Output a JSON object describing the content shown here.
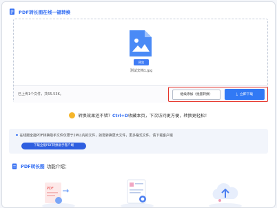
{
  "header": {
    "title": "PDF转长图在线一键转换"
  },
  "upload": {
    "file_badge": "预览",
    "file_name": "测试文档1.jpg",
    "status": "已上传1个文件，共65.53K。",
    "continue_label": "继续添加（批量转换）",
    "download_label": "立即下载"
  },
  "tip": {
    "prefix": "转换效果还不错？",
    "shortcut": "Ctrl+D",
    "suffix": "收藏本页，下次访问更方便，转换更轻松！"
  },
  "info": {
    "text": "在线版全能PDF转换助手文件仅限于2M以内的文件，如需转换更大文件，更多格式文件，请下载客户端",
    "button_label": "下载全能PDF转换助手客户端"
  },
  "intro": {
    "title_accent": "PDF转长图",
    "title_rest": "功能介绍："
  },
  "colors": {
    "accent": "#2f6bf2",
    "download": "#3179f5",
    "highlight": "#e6332a",
    "smile": "#f5b52a"
  }
}
